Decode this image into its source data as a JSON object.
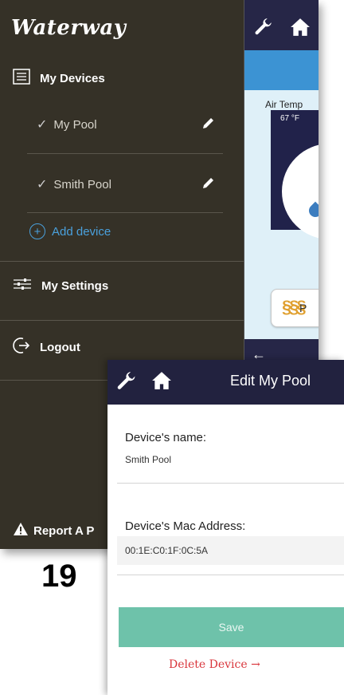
{
  "sidebar": {
    "logo": "Waterway",
    "my_devices": "My Devices",
    "devices": [
      {
        "name": "My Pool"
      },
      {
        "name": "Smith Pool"
      }
    ],
    "add_device": "Add device",
    "my_settings": "My Settings",
    "logout": "Logout",
    "report": "Report A P"
  },
  "background_app": {
    "air_temp_label": "Air Temp",
    "air_temp_value": "67 °F",
    "pill_label": "P"
  },
  "page_number": "19",
  "edit_screen": {
    "title": "Edit My Pool",
    "device_name_label": "Device's name:",
    "device_name_value": "Smith Pool",
    "mac_label": "Device's Mac Address:",
    "mac_value": "00:1E:C0:1F:0C:5A",
    "save_label": "Save",
    "delete_label": "Delete Device →"
  },
  "colors": {
    "sidebar_bg": "#353127",
    "topbar_bg": "#22223f",
    "accent_blue": "#4aa0dc",
    "save_green": "#6ec2aa",
    "delete_red": "#d9363c"
  },
  "icons": [
    "wrench-icon",
    "home-icon",
    "list-icon",
    "check-icon",
    "pencil-icon",
    "add-circle-icon",
    "settings-sliders-icon",
    "logout-icon",
    "warning-icon",
    "back-arrow-icon",
    "heat-icon"
  ]
}
